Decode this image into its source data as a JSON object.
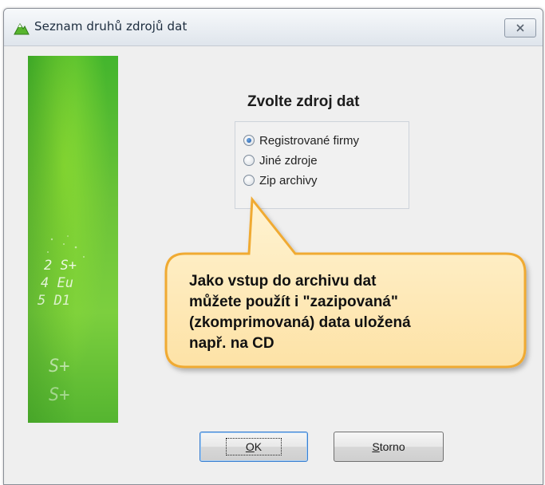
{
  "window": {
    "title": "Seznam druhů zdrojů dat"
  },
  "banner": {
    "text_lines": [
      "2 S+",
      "4 Eu",
      "5 D1",
      "S+",
      "S+"
    ]
  },
  "data_source": {
    "heading": "Zvolte zdroj dat",
    "options": [
      {
        "label": "Registrované firmy",
        "selected": true
      },
      {
        "label": "Jiné zdroje",
        "selected": false
      },
      {
        "label": "Zip archivy",
        "selected": false
      }
    ]
  },
  "callout": {
    "lines": [
      "Jako vstup do archivu dat",
      "můžete použít i \"zazipovaná\"",
      "(zkomprimovaná) data uložená",
      "např. na CD"
    ],
    "fill_color": "#fde7b3",
    "border_color": "#f2b23b"
  },
  "buttons": {
    "ok": {
      "mnemonic": "O",
      "rest": "K"
    },
    "cancel": {
      "mnemonic": "S",
      "rest": "torno"
    }
  },
  "colors": {
    "banner_green": "#6cc338",
    "focus_blue": "#3a7fd0"
  },
  "icons": {
    "app": "green-mountain-icon",
    "close": "close-x-icon"
  }
}
